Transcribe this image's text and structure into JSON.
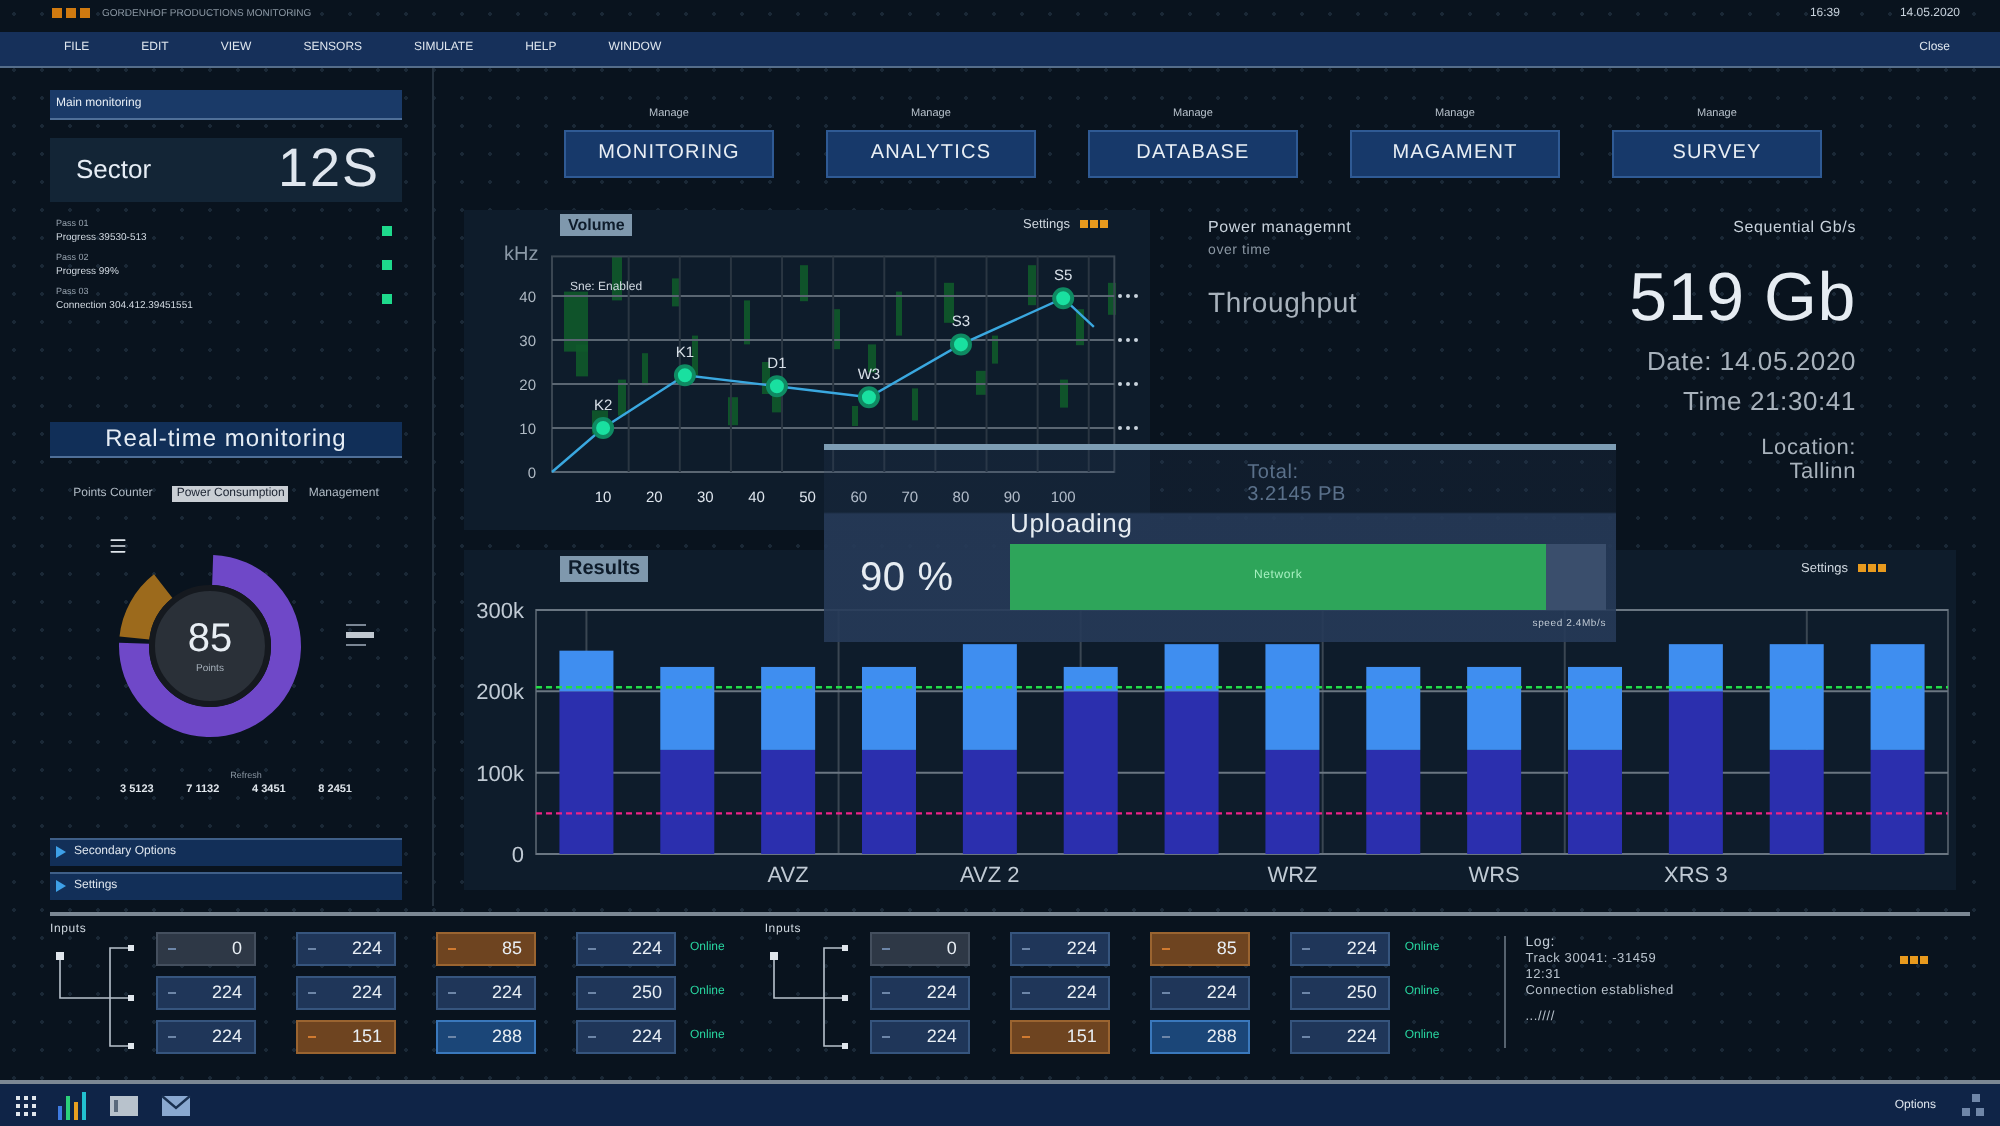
{
  "app": {
    "title": "GORDENHOF PRODUCTIONS MONITORING",
    "time": "16:39",
    "date": "14.05.2020"
  },
  "menu": {
    "items": [
      "FILE",
      "EDIT",
      "VIEW",
      "SENSORS",
      "SIMULATE",
      "HELP",
      "WINDOW"
    ],
    "close": "Close"
  },
  "main_monitoring": {
    "title": "Main monitoring",
    "sector_label": "Sector",
    "sector_value": "12S",
    "entries": [
      {
        "name": "Pass 01",
        "detail": "Progress 39530-513"
      },
      {
        "name": "Pass 02",
        "detail": "Progress 99%"
      },
      {
        "name": "Pass 03",
        "detail": "Connection 304.412.39451551"
      }
    ]
  },
  "realtime": {
    "title": "Real-time monitoring",
    "tabs": [
      {
        "label": "Points Counter",
        "selected": false
      },
      {
        "label": "Power Consumption",
        "selected": true
      },
      {
        "label": "Management",
        "selected": false
      }
    ],
    "gauge": {
      "value": "85",
      "unit": "Points"
    },
    "refresh_label": "Refresh",
    "counters": [
      "3 5123",
      "7 1132",
      "4 3451",
      "8 2451"
    ],
    "options": [
      {
        "label": "Secondary Options"
      },
      {
        "label": "Settings"
      }
    ]
  },
  "manage": [
    {
      "caption": "Manage",
      "label": "MONITORING"
    },
    {
      "caption": "Manage",
      "label": "ANALYTICS"
    },
    {
      "caption": "Manage",
      "label": "DATABASE"
    },
    {
      "caption": "Manage",
      "label": "MAGAMENT"
    },
    {
      "caption": "Manage",
      "label": "SURVEY"
    }
  ],
  "volume_panel": {
    "tag": "Volume",
    "settings": "Settings",
    "note": "Sne: Enabled",
    "chart_data": {
      "type": "line",
      "ylabel": "kHz",
      "x": [
        0,
        10,
        26,
        44,
        62,
        80,
        100,
        106
      ],
      "grid": true,
      "series": [
        {
          "color": "#3aa8e0",
          "values": [
            0,
            10,
            22,
            19.5,
            17,
            29,
            39.5,
            33
          ]
        }
      ],
      "xlim": [
        0,
        110
      ],
      "ylim": [
        0,
        49
      ],
      "xticks": [
        10,
        20,
        30,
        40,
        50,
        60,
        70,
        80,
        90,
        100
      ],
      "yticks": [
        0,
        10,
        20,
        30,
        40
      ],
      "annotations": [
        {
          "x": 10,
          "y": 10,
          "text": "K2"
        },
        {
          "x": 26,
          "y": 22,
          "text": "K1"
        },
        {
          "x": 44,
          "y": 19.5,
          "text": "D1"
        },
        {
          "x": 62,
          "y": 17,
          "text": "W3"
        },
        {
          "x": 80,
          "y": 29,
          "text": "S3"
        },
        {
          "x": 100,
          "y": 39.5,
          "text": "S5"
        }
      ]
    }
  },
  "info": {
    "power": "Power managemnt",
    "period": "over time",
    "throughput": "Throughput",
    "sequential": "Sequential Gb/s",
    "amount": "519 Gb",
    "date": "Date: 14.05.2020",
    "time": "Time 21:30:41",
    "location_label": "Location:",
    "location": "Tallinn"
  },
  "upload_dialog": {
    "total_label": "Total:",
    "total": "3.2145 PB",
    "title": "Uploading",
    "percent": "90 %",
    "level": 0.9,
    "bar_label": "Network",
    "speed": "speed 2.4Mb/s"
  },
  "results_panel": {
    "tag": "Results",
    "settings": "Settings",
    "chart_data": {
      "type": "bar",
      "stacked": true,
      "categories": [
        null,
        null,
        "AVZ",
        null,
        "AVZ 2",
        null,
        null,
        "WRZ",
        null,
        "WRS",
        null,
        "XRS 3",
        null,
        null
      ],
      "grid": true,
      "series": [
        {
          "color": "#2b2fae",
          "values": [
            200000,
            128000,
            128000,
            128000,
            128000,
            200000,
            200000,
            128000,
            128000,
            128000,
            128000,
            200000,
            128000,
            128000
          ]
        },
        {
          "color": "#3f8ef0",
          "values": [
            50000,
            102000,
            102000,
            102000,
            130000,
            30000,
            58000,
            130000,
            102000,
            102000,
            102000,
            58000,
            130000,
            130000
          ]
        }
      ],
      "ylim": [
        0,
        300000
      ],
      "yticks": [
        {
          "value": 0,
          "label": "0"
        },
        {
          "value": 100000,
          "label": "100k"
        },
        {
          "value": 200000,
          "label": "200k"
        },
        {
          "value": 300000,
          "label": "300k"
        }
      ],
      "ref_lines": [
        {
          "axis": "y",
          "value": 205000,
          "color": "#22dd44"
        },
        {
          "axis": "y",
          "value": 50000,
          "color": "#ee2288"
        }
      ]
    }
  },
  "input_groups": [
    {
      "label": "Inputs",
      "rows": [
        {
          "cells": [
            {
              "value": "0",
              "kind": "idle"
            },
            {
              "value": "224",
              "kind": "normal"
            },
            {
              "value": "85",
              "kind": "alert"
            },
            {
              "value": "224",
              "kind": "normal"
            }
          ],
          "status": "Online"
        },
        {
          "cells": [
            {
              "value": "224",
              "kind": "normal"
            },
            {
              "value": "224",
              "kind": "normal"
            },
            {
              "value": "224",
              "kind": "normal"
            },
            {
              "value": "250",
              "kind": "normal"
            }
          ],
          "status": "Online"
        },
        {
          "cells": [
            {
              "value": "224",
              "kind": "normal"
            },
            {
              "value": "151",
              "kind": "alert"
            },
            {
              "value": "288",
              "kind": "active"
            },
            {
              "value": "224",
              "kind": "normal"
            }
          ],
          "status": "Online"
        }
      ]
    },
    {
      "label": "Inputs",
      "rows": [
        {
          "cells": [
            {
              "value": "0",
              "kind": "idle"
            },
            {
              "value": "224",
              "kind": "normal"
            },
            {
              "value": "85",
              "kind": "alert"
            },
            {
              "value": "224",
              "kind": "normal"
            }
          ],
          "status": "Online"
        },
        {
          "cells": [
            {
              "value": "224",
              "kind": "normal"
            },
            {
              "value": "224",
              "kind": "normal"
            },
            {
              "value": "224",
              "kind": "normal"
            },
            {
              "value": "250",
              "kind": "normal"
            }
          ],
          "status": "Online"
        },
        {
          "cells": [
            {
              "value": "224",
              "kind": "normal"
            },
            {
              "value": "151",
              "kind": "alert"
            },
            {
              "value": "288",
              "kind": "active"
            },
            {
              "value": "224",
              "kind": "normal"
            }
          ],
          "status": "Online"
        }
      ]
    }
  ],
  "log": {
    "title": "Log:",
    "lines": [
      "Track 30041: -31459",
      "12:31",
      "Connection established",
      "...////"
    ]
  },
  "taskbar": {
    "options": "Options"
  }
}
